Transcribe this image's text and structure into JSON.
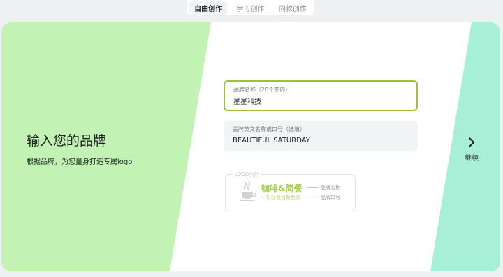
{
  "tabs": [
    {
      "label": "自由创作",
      "active": true
    },
    {
      "label": "字母创作",
      "active": false
    },
    {
      "label": "同款创作",
      "active": false
    }
  ],
  "intro": {
    "title": "输入您的品牌",
    "subtitle": "根据品牌，为您量身打造专属logo"
  },
  "fields": {
    "brand_name": {
      "label": "品牌名称（20个字内）",
      "value": "星星科技"
    },
    "brand_english": {
      "label": "品牌英文名称或口号（选填）",
      "value": "BEAUTIFUL SATURDAY"
    }
  },
  "logo_example": {
    "legend": "LOGO示例",
    "title": "咖啡&简餐",
    "slogan": "一份轻食清新惬意",
    "name_annotation": "品牌名称",
    "slogan_annotation": "品牌口号"
  },
  "next": {
    "label": "继续",
    "icon": "chevron-right-icon"
  },
  "colors": {
    "left_panel": "#c2f2b4",
    "right_panel": "#a7efd7",
    "accent": "#9bc43b",
    "page_bg": "#eef1f2"
  }
}
